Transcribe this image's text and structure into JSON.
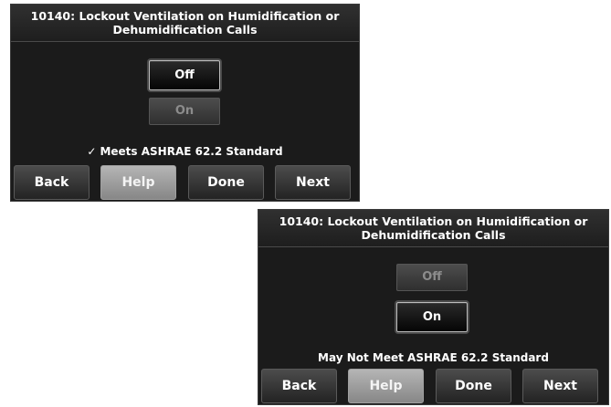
{
  "screens": [
    {
      "title_line1": "10140: Lockout Ventilation on Humidification or",
      "title_line2": "Dehumidification Calls",
      "options": {
        "off": "Off",
        "on": "On"
      },
      "selected": "Off",
      "status_check": "✓",
      "status": "Meets ASHRAE 62.2 Standard",
      "buttons": {
        "back": "Back",
        "help": "Help",
        "done": "Done",
        "next": "Next"
      }
    },
    {
      "title_line1": "10140: Lockout Ventilation on Humidification or",
      "title_line2": "Dehumidification Calls",
      "options": {
        "off": "Off",
        "on": "On"
      },
      "selected": "On",
      "status": "May Not Meet ASHRAE 62.2 Standard",
      "buttons": {
        "back": "Back",
        "help": "Help",
        "done": "Done",
        "next": "Next"
      }
    }
  ]
}
